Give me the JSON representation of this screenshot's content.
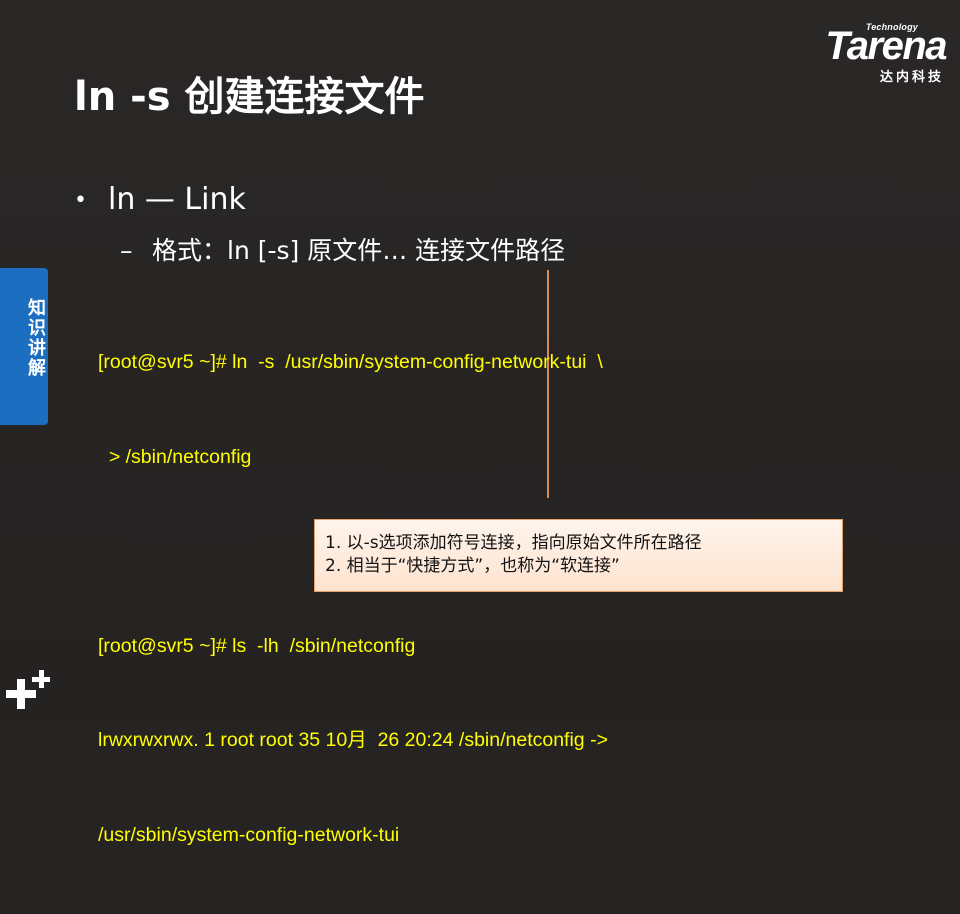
{
  "logo": {
    "small": "Technology",
    "main": "Tarena",
    "cn": "达内科技"
  },
  "title": "ln -s 创建连接文件",
  "bullets": {
    "level1_marker": "•",
    "level1": "ln — Link",
    "level2_marker": "–",
    "level2": "格式：ln  [-s]  原文件…  连接文件路径"
  },
  "code_lines": [
    "[root@svr5 ~]# ln  -s  /usr/sbin/system-config-network-tui  \\",
    "  > /sbin/netconfig",
    "",
    "[root@svr5 ~]# ls  -lh  /sbin/netconfig",
    "lrwxrwxrwx. 1 root root 35 10月  26 20:24 /sbin/netconfig ->",
    "/usr/sbin/system-config-network-tui"
  ],
  "side_tab": "知识讲解",
  "note": {
    "line1": "1. 以-s选项添加符号连接，指向原始文件所在路径",
    "line2": "2. 相当于“快捷方式”，也称为“软连接”"
  },
  "colors": {
    "background": "#262323",
    "code_text": "#ffff00",
    "side_tab": "#1c6fc0",
    "note_background": "#fde3cf",
    "note_border": "#e6a06a",
    "separator": "#d98c4a"
  }
}
